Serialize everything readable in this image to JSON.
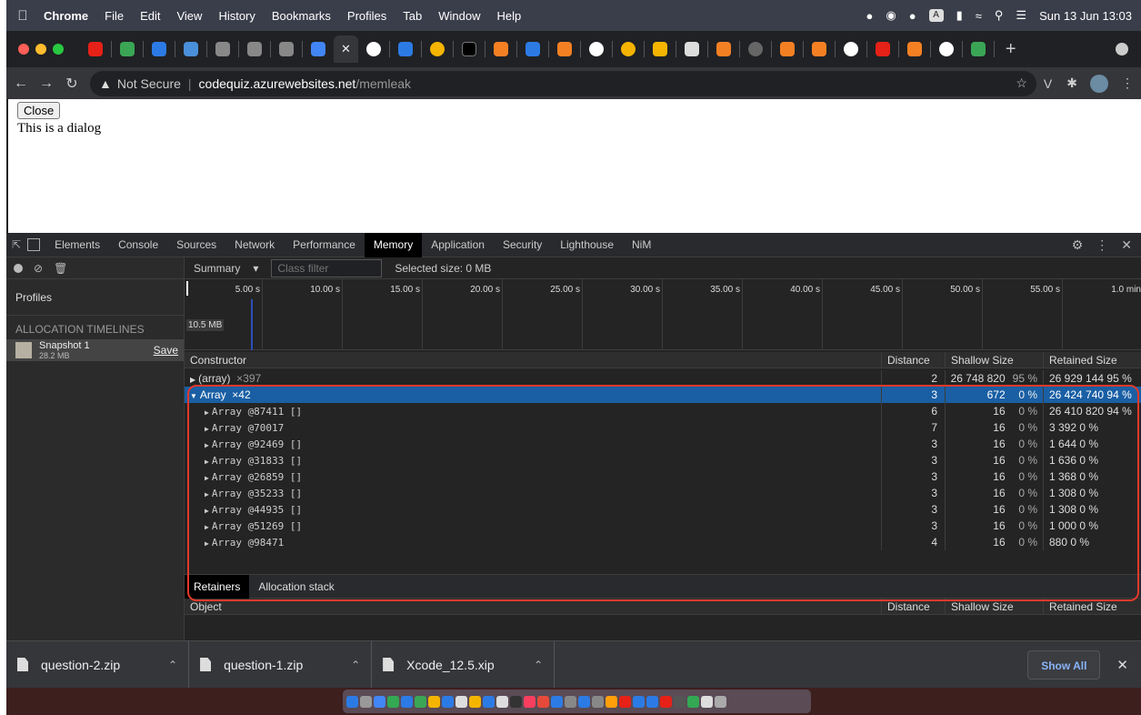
{
  "menubar": {
    "app": "Chrome",
    "items": [
      "File",
      "Edit",
      "View",
      "History",
      "Bookmarks",
      "Profiles",
      "Tab",
      "Window",
      "Help"
    ],
    "clock": "Sun 13 Jun 13:03",
    "input_badge": "A"
  },
  "browser": {
    "security_label": "Not Secure",
    "url_host": "codequiz.azurewebsites.net",
    "url_path": "/memleak"
  },
  "page": {
    "close_button": "Close",
    "dialog_text": "This is a dialog"
  },
  "devtools": {
    "tabs": [
      "Elements",
      "Console",
      "Sources",
      "Network",
      "Performance",
      "Memory",
      "Application",
      "Security",
      "Lighthouse",
      "NiM"
    ],
    "active_tab": "Memory"
  },
  "memory": {
    "profiles_label": "Profiles",
    "group_label": "ALLOCATION TIMELINES",
    "snapshot": {
      "name": "Snapshot 1",
      "size": "28.2 MB",
      "save": "Save"
    },
    "view": "Summary",
    "class_filter_placeholder": "Class filter",
    "selected_size": "Selected size: 0 MB",
    "timeline_ticks": [
      "5.00 s",
      "10.00 s",
      "15.00 s",
      "20.00 s",
      "25.00 s",
      "30.00 s",
      "35.00 s",
      "40.00 s",
      "45.00 s",
      "50.00 s",
      "55.00 s",
      "1.0 min"
    ],
    "timeline_heap": "10.5 MB",
    "columns": {
      "constructor": "Constructor",
      "distance": "Distance",
      "shallow": "Shallow Size",
      "retained": "Retained Size"
    },
    "rows": [
      {
        "name": "(array)",
        "count": "×397",
        "distance": "2",
        "shallow": "26 748 820",
        "shallow_pct": "95 %",
        "retained": "26 929 144 95 %"
      },
      {
        "name": "Array",
        "count": "×42",
        "distance": "3",
        "shallow": "672",
        "shallow_pct": "0 %",
        "retained": "26 424 740 94 %"
      }
    ],
    "children": [
      {
        "name": "Array @87411 []",
        "distance": "6",
        "shallow": "16",
        "shallow_pct": "0 %",
        "retained": "26 410 820 94 %"
      },
      {
        "name": "Array @70017",
        "distance": "7",
        "shallow": "16",
        "shallow_pct": "0 %",
        "retained": "3 392  0 %"
      },
      {
        "name": "Array @92469 []",
        "distance": "3",
        "shallow": "16",
        "shallow_pct": "0 %",
        "retained": "1 644  0 %"
      },
      {
        "name": "Array @31833 []",
        "distance": "3",
        "shallow": "16",
        "shallow_pct": "0 %",
        "retained": "1 636  0 %"
      },
      {
        "name": "Array @26859 []",
        "distance": "3",
        "shallow": "16",
        "shallow_pct": "0 %",
        "retained": "1 368  0 %"
      },
      {
        "name": "Array @35233 []",
        "distance": "3",
        "shallow": "16",
        "shallow_pct": "0 %",
        "retained": "1 308  0 %"
      },
      {
        "name": "Array @44935 []",
        "distance": "3",
        "shallow": "16",
        "shallow_pct": "0 %",
        "retained": "1 308  0 %"
      },
      {
        "name": "Array @51269 []",
        "distance": "3",
        "shallow": "16",
        "shallow_pct": "0 %",
        "retained": "1 000  0 %"
      },
      {
        "name": "Array @98471",
        "distance": "4",
        "shallow": "16",
        "shallow_pct": "0 %",
        "retained": "880  0 %"
      }
    ],
    "bottom_tabs": [
      "Retainers",
      "Allocation stack"
    ],
    "retainer_columns": {
      "object": "Object",
      "distance": "Distance",
      "shallow": "Shallow Size",
      "retained": "Retained Size"
    }
  },
  "downloads": {
    "files": [
      "question-2.zip",
      "question-1.zip",
      "Xcode_12.5.xip"
    ],
    "show_all": "Show All"
  },
  "colors": {
    "accent": "#1a5fa4",
    "highlight": "#e0392b"
  }
}
